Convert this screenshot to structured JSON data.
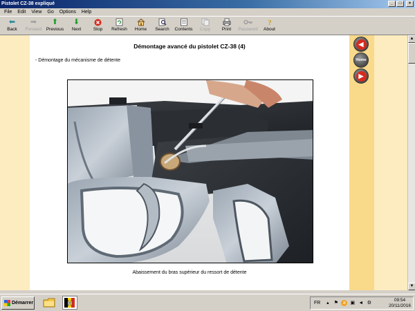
{
  "window": {
    "title": "Pistolet CZ-38 expliqué"
  },
  "menu": [
    "File",
    "Edit",
    "View",
    "Go",
    "Options",
    "Help"
  ],
  "toolbar": [
    {
      "label": "Back",
      "icon": "back-arrow-icon",
      "enabled": true
    },
    {
      "label": "Forward",
      "icon": "forward-arrow-icon",
      "enabled": false
    },
    {
      "label": "Previous",
      "icon": "up-arrow-icon",
      "enabled": true
    },
    {
      "label": "Next",
      "icon": "down-arrow-icon",
      "enabled": true
    },
    {
      "label": "Stop",
      "icon": "stop-icon",
      "enabled": true
    },
    {
      "label": "Refresh",
      "icon": "refresh-icon",
      "enabled": true
    },
    {
      "label": "Home",
      "icon": "home-icon",
      "enabled": true
    },
    {
      "label": "Search",
      "icon": "search-icon",
      "enabled": true
    },
    {
      "label": "Contents",
      "icon": "contents-icon",
      "enabled": true
    },
    {
      "label": "Copy",
      "icon": "copy-icon",
      "enabled": false
    },
    {
      "label": "Print",
      "icon": "print-icon",
      "enabled": true
    },
    {
      "label": "Password",
      "icon": "key-icon",
      "enabled": false
    },
    {
      "label": "About",
      "icon": "about-icon",
      "enabled": true
    }
  ],
  "page": {
    "heading": "Démontage avancé du pistolet CZ-38 (4)",
    "subheading": "- Démontage du mécanisme de détente",
    "caption": "Abaissement du bras supérieur du ressort de détente"
  },
  "nav": {
    "home_label": "Home"
  },
  "taskbar": {
    "start_label": "Démarrer",
    "lang": "FR",
    "time": "09:54",
    "date": "20/11/2016"
  },
  "colors": {
    "page_bg": "#fcecc0",
    "sidebar": "#f9d98a",
    "nav_red": "#d52b1e",
    "titlebar": "#0a246a"
  }
}
